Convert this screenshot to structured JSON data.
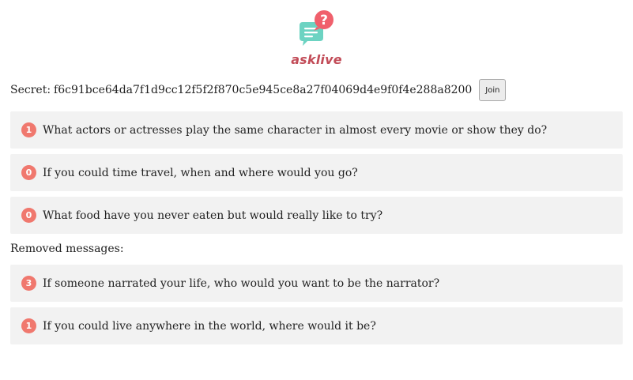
{
  "app": {
    "name": "asklive",
    "logo_icon": "chat-question-icon",
    "brand_color": "#c24c58",
    "accent_color": "#f0786e"
  },
  "secret": {
    "label": "Secret:",
    "value": "f6c91bce64da7f1d9cc12f5f2f870c5e945ce8a27f04069d4e9f0f4e288a8200",
    "join_label": "Join"
  },
  "messages": [
    {
      "votes": "1",
      "text": "What actors or actresses play the same character in almost every movie or show they do?"
    },
    {
      "votes": "0",
      "text": "If you could time travel, when and where would you go?"
    },
    {
      "votes": "0",
      "text": "What food have you never eaten but would really like to try?"
    }
  ],
  "removed": {
    "title": "Removed messages:",
    "messages": [
      {
        "votes": "3",
        "text": "If someone narrated your life, who would you want to be the narrator?"
      },
      {
        "votes": "1",
        "text": "If you could live anywhere in the world, where would it be?"
      }
    ]
  }
}
